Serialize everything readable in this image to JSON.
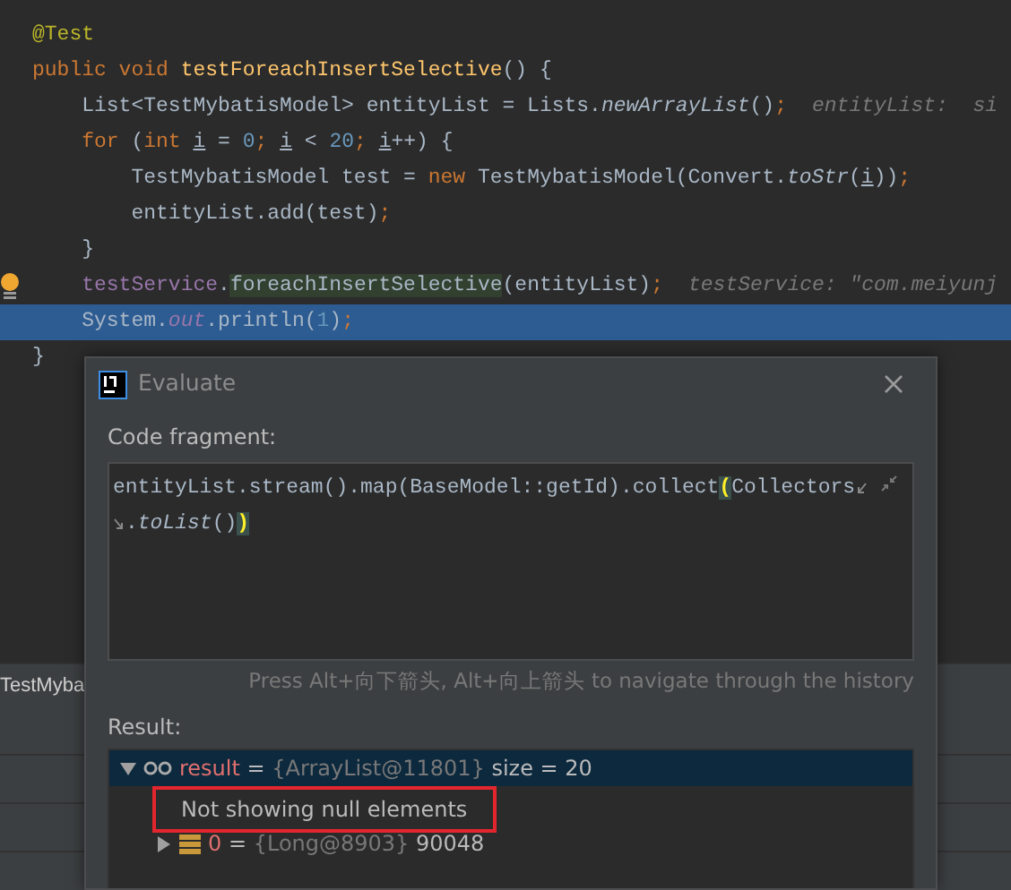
{
  "editor": {
    "lines": [
      {
        "tokens": [
          {
            "text": "@Test",
            "kind": "annotation"
          }
        ]
      },
      {
        "tokens": [
          {
            "text": "public void ",
            "kind": "kw"
          },
          {
            "text": "testForeachInsertSelective",
            "kind": "method"
          },
          {
            "text": "() {",
            "kind": "plain"
          }
        ]
      },
      {
        "tokens": [
          {
            "text": "    List<TestMybatisModel> entityList = Lists.",
            "kind": "plain"
          },
          {
            "text": "newArrayList",
            "kind": "static"
          },
          {
            "text": "()",
            "kind": "plain"
          },
          {
            "text": ";",
            "kind": "kw"
          }
        ],
        "hint": "entityList:  si"
      },
      {
        "tokens": [
          {
            "text": "    for",
            "kind": "kw"
          },
          {
            "text": " (",
            "kind": "plain"
          },
          {
            "text": "int ",
            "kind": "kw"
          },
          {
            "text": "i",
            "kind": "var"
          },
          {
            "text": " = ",
            "kind": "plain"
          },
          {
            "text": "0",
            "kind": "num"
          },
          {
            "text": "; ",
            "kind": "kw"
          },
          {
            "text": "i",
            "kind": "var"
          },
          {
            "text": " < ",
            "kind": "plain"
          },
          {
            "text": "20",
            "kind": "num"
          },
          {
            "text": "; ",
            "kind": "kw"
          },
          {
            "text": "i",
            "kind": "var"
          },
          {
            "text": "++) {",
            "kind": "plain"
          }
        ]
      },
      {
        "tokens": [
          {
            "text": "        TestMybatisModel test = ",
            "kind": "plain"
          },
          {
            "text": "new",
            "kind": "kw"
          },
          {
            "text": " TestMybatisModel(Convert.",
            "kind": "plain"
          },
          {
            "text": "toStr",
            "kind": "static"
          },
          {
            "text": "(",
            "kind": "plain"
          },
          {
            "text": "i",
            "kind": "var"
          },
          {
            "text": "))",
            "kind": "plain"
          },
          {
            "text": ";",
            "kind": "kw"
          }
        ]
      },
      {
        "tokens": [
          {
            "text": "        entityList.add(test)",
            "kind": "plain"
          },
          {
            "text": ";",
            "kind": "kw"
          }
        ]
      },
      {
        "tokens": [
          {
            "text": "    }",
            "kind": "plain"
          }
        ]
      },
      {
        "tokens": [
          {
            "text": "    testService",
            "kind": "member"
          },
          {
            "text": ".",
            "kind": "plain"
          },
          {
            "text": "foreachInsertSelective",
            "kind": "highlight"
          },
          {
            "text": "(entityList)",
            "kind": "plain"
          },
          {
            "text": ";",
            "kind": "kw"
          }
        ],
        "hint": "testService: \"com.meiyunj",
        "intention": true
      },
      {
        "tokens": [
          {
            "text": "    System.",
            "kind": "plain"
          },
          {
            "text": "out",
            "kind": "field"
          },
          {
            "text": ".println(",
            "kind": "plain"
          },
          {
            "text": "1",
            "kind": "num"
          },
          {
            "text": ")",
            "kind": "plain"
          },
          {
            "text": ";",
            "kind": "kw"
          }
        ],
        "execution": true
      },
      {
        "tokens": [
          {
            "text": "}",
            "kind": "plain"
          }
        ]
      }
    ]
  },
  "background_tab": {
    "label": "TestMyba"
  },
  "dialog": {
    "title": "Evaluate",
    "code_label": "Code fragment:",
    "code_lines": [
      [
        {
          "text": "entityList.stream().map(BaseModel::getId).collect",
          "kind": "plain"
        },
        {
          "text": "(",
          "kind": "brace"
        },
        {
          "text": "Collectors",
          "kind": "plain"
        }
      ],
      [
        {
          "text": ".",
          "kind": "plain"
        },
        {
          "text": "toList",
          "kind": "static"
        },
        {
          "text": "()",
          "kind": "plain"
        },
        {
          "text": ")",
          "kind": "brace"
        }
      ]
    ],
    "history_hint": "Press Alt+向下箭头, Alt+向上箭头 to navigate through the history",
    "result_label": "Result:",
    "tree": [
      {
        "kind": "node",
        "name": "result",
        "separator": "=",
        "type": "{ArrayList@11801}",
        "value": "size = 20",
        "expanded": true,
        "selected": true,
        "children": [
          {
            "kind": "message",
            "text": "Not showing null elements",
            "boxed": true
          },
          {
            "kind": "node",
            "name": "0",
            "separator": "=",
            "type": "{Long@8903}",
            "value": "90048",
            "expanded": false,
            "selected": false
          }
        ]
      }
    ]
  }
}
